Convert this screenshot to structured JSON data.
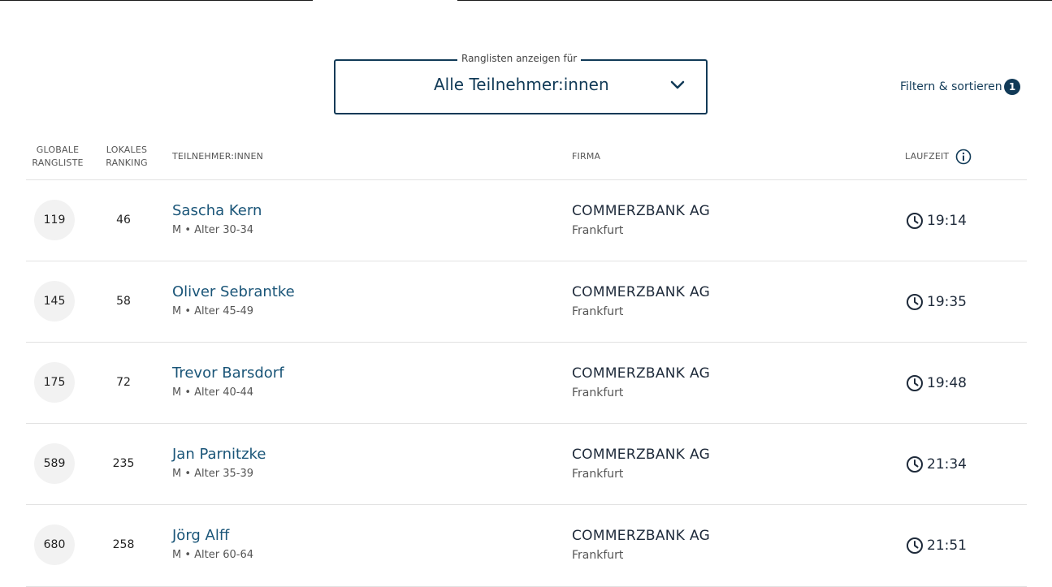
{
  "filter": {
    "legend": "Ranglisten anzeigen für",
    "selected": "Alle Teilnehmer:innen",
    "sort_label": "Filtern & sortieren",
    "active_count": "1"
  },
  "table": {
    "headers": {
      "global_line1": "GLOBALE",
      "global_line2": "RANGLISTE",
      "local_line1": "LOKALES",
      "local_line2": "RANKING",
      "participants": "TEILNEHMER:INNEN",
      "company": "FIRMA",
      "time": "LAUFZEIT"
    },
    "rows": [
      {
        "global": "119",
        "local": "46",
        "name": "Sascha Kern",
        "meta": "M • Alter 30-34",
        "company": "COMMERZBANK AG",
        "city": "Frankfurt",
        "time": "19:14"
      },
      {
        "global": "145",
        "local": "58",
        "name": "Oliver Sebrantke",
        "meta": "M • Alter 45-49",
        "company": "COMMERZBANK AG",
        "city": "Frankfurt",
        "time": "19:35"
      },
      {
        "global": "175",
        "local": "72",
        "name": "Trevor Barsdorf",
        "meta": "M • Alter 40-44",
        "company": "COMMERZBANK AG",
        "city": "Frankfurt",
        "time": "19:48"
      },
      {
        "global": "589",
        "local": "235",
        "name": "Jan Parnitzke",
        "meta": "M • Alter 35-39",
        "company": "COMMERZBANK AG",
        "city": "Frankfurt",
        "time": "21:34"
      },
      {
        "global": "680",
        "local": "258",
        "name": "Jörg Alff",
        "meta": "M • Alter 60-64",
        "company": "COMMERZBANK AG",
        "city": "Frankfurt",
        "time": "21:51"
      }
    ]
  },
  "icons": {
    "dropdown": "chevron-down-icon",
    "info": "info-icon",
    "time": "clock-icon"
  },
  "colors": {
    "accent": "#113a57",
    "link": "#1a5578",
    "rank_bg": "#f2f2f2"
  }
}
